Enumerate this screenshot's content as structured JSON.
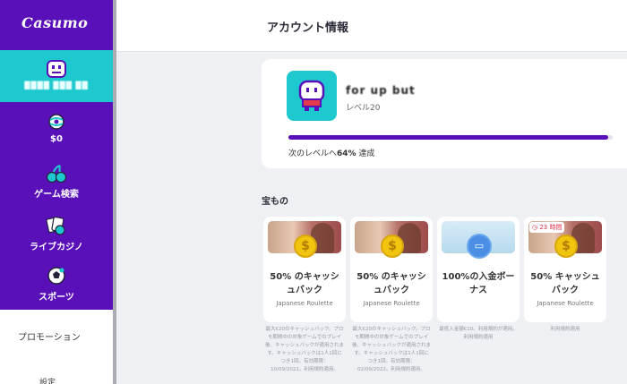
{
  "sidebar": {
    "logo": "Casumo",
    "items": [
      {
        "label": "████ ███ ██",
        "icon": "profile-face-icon",
        "active": true
      },
      {
        "label": "$0",
        "icon": "wallet-globe-icon"
      },
      {
        "label": "ゲーム検索",
        "icon": "cherries-icon"
      },
      {
        "label": "ライブカジノ",
        "icon": "cards-chip-icon"
      },
      {
        "label": "スポーツ",
        "icon": "soccer-ball-icon"
      }
    ],
    "promotions": "プロモーション",
    "settings": "設定"
  },
  "header": {
    "title": "アカウント情報"
  },
  "profile": {
    "username": "for up but",
    "level": "レベル20",
    "progress_prefix": "次のレベルへ",
    "progress_value": "64%",
    "progress_suffix": " 達成",
    "progress_fraction": 0.985
  },
  "treasures": {
    "title": "宝もの",
    "cards": [
      {
        "name": "50% のキャッシュバック",
        "game": "Japanese Roulette",
        "type": "cashback",
        "badge": "",
        "desc": "最大€20のキャッシュバック。プロモ期間中の対象ゲームでのプレイ後、キャッシュバックが適用されます。キャッシュバックは1人1回につき1回。有効期限：10/09/2022。利用規約適用。"
      },
      {
        "name": "50% のキャッシュバック",
        "game": "Japanese Roulette",
        "type": "cashback",
        "badge": "",
        "desc": "最大€20のキャッシュバック。プロモ期間中の対象ゲームでのプレイ後、キャッシュバックが適用されます。キャッシュバックは1人1回につき1回。有効期限：02/09/2022。利用規約適用。"
      },
      {
        "name": "100%の入金ボーナス",
        "game": "",
        "type": "deposit",
        "badge": "",
        "desc": "最低入金額€10。利用規約が適用。利用規約適用"
      },
      {
        "name": "50% キャッシュバック",
        "game": "Japanese Roulette",
        "type": "cashback",
        "badge": "23 時間",
        "desc": "利用規約適用"
      }
    ]
  }
}
